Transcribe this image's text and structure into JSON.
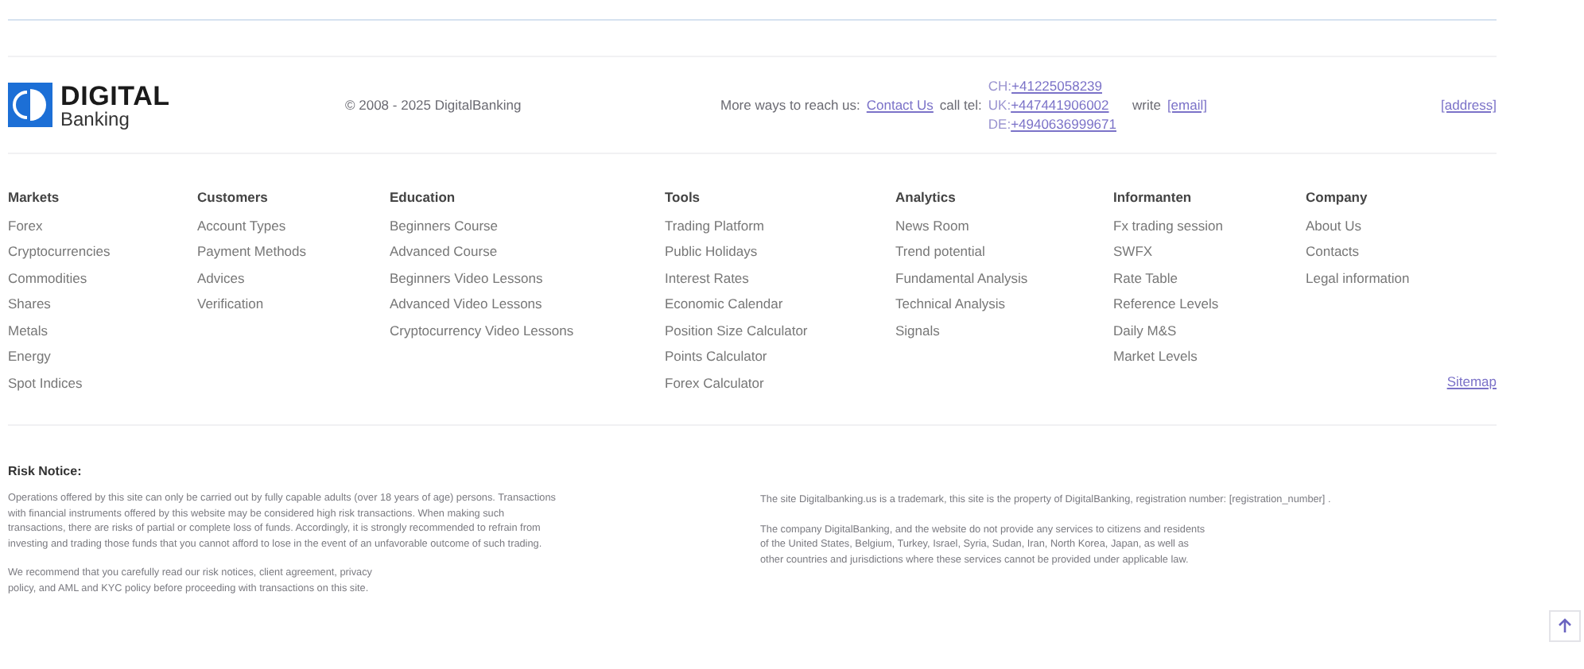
{
  "brand": {
    "name": "DIGITAL",
    "sub": "Banking"
  },
  "copyright": "© 2008 - 2025 DigitalBanking",
  "contact": {
    "intro": "More ways to reach us:",
    "link": "Contact Us",
    "call": "call tel:",
    "phones": [
      {
        "code": "CH:",
        "number": "+41225058239"
      },
      {
        "code": "UK:",
        "number": "+447441906002"
      },
      {
        "code": "DE:",
        "number": "+4940636999671"
      }
    ],
    "write": "write",
    "email": "[email]",
    "address": "[address]"
  },
  "columns": [
    {
      "title": "Markets",
      "links": [
        "Forex",
        "Cryptocurrencies",
        "Commodities",
        "Shares",
        "Metals",
        "Energy",
        "Spot Indices"
      ]
    },
    {
      "title": "Customers",
      "links": [
        "Account Types",
        "Payment Methods",
        "Advices",
        "Verification"
      ]
    },
    {
      "title": "Education",
      "links": [
        "Beginners Course",
        "Advanced Course",
        "Beginners Video Lessons",
        "Advanced Video Lessons",
        "Cryptocurrency Video Lessons"
      ]
    },
    {
      "title": "Tools",
      "links": [
        "Trading Platform",
        "Public Holidays",
        "Interest Rates",
        "Economic Calendar",
        "Position Size Calculator",
        "Points Calculator",
        "Forex Calculator"
      ]
    },
    {
      "title": "Analytics",
      "links": [
        "News Room",
        "Trend potential",
        "Fundamental Analysis",
        "Technical Analysis",
        "Signals"
      ]
    },
    {
      "title": "Informanten",
      "links": [
        "Fx trading session",
        "SWFX",
        "Rate Table",
        "Reference Levels",
        "Daily M&S",
        "Market Levels"
      ]
    },
    {
      "title": "Company",
      "links": [
        "About Us",
        "Contacts",
        "Legal information"
      ]
    }
  ],
  "sitemap": "Sitemap",
  "risk": {
    "title": "Risk Notice:",
    "left": [
      "Operations offered by this site can only be carried out by fully capable adults (over 18 years of age) persons. Transactions\nwith financial instruments offered by this website may be considered high risk transactions. When making such\ntransactions, there are risks of partial or complete loss of funds. Accordingly, it is strongly recommended to refrain from\ninvesting and trading those funds that you cannot afford to lose in the event of an unfavorable outcome of such trading.",
      "We recommend that you carefully read our risk notices, client agreement, privacy\npolicy, and AML and KYC policy before proceeding with transactions on this site."
    ],
    "right": [
      "The site Digitalbanking.us is a trademark, this site is the property of DigitalBanking, registration number: [registration_number] .",
      "The company DigitalBanking, and the website do not provide any services to citizens and residents\nof the United States, Belgium, Turkey, Israel, Syria, Sudan, Iran, North Korea, Japan, as well as\nother countries and jurisdictions where these services cannot be provided under applicable law."
    ]
  }
}
